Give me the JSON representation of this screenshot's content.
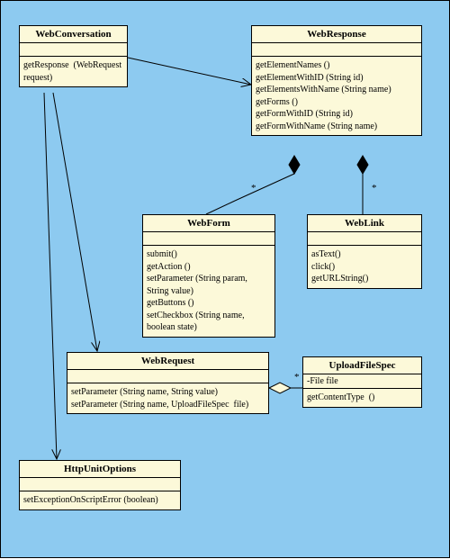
{
  "classes": {
    "WebConversation": {
      "name": "WebConversation",
      "ops": [
        "getResponse  (WebRequest request)"
      ]
    },
    "WebResponse": {
      "name": "WebResponse",
      "ops": [
        "getElementNames ()",
        "getElementWithID (String id)",
        "getElementsWithName (String name)",
        "getForms ()",
        "getFormWithID (String id)",
        "getFormWithName (String name)"
      ]
    },
    "WebForm": {
      "name": "WebForm",
      "ops": [
        "submit()",
        "getAction ()",
        "setParameter (String param, String value)",
        "getButtons ()",
        "setCheckbox (String name, boolean state)"
      ]
    },
    "WebLink": {
      "name": "WebLink",
      "ops": [
        "asText()",
        "click()",
        "getURLString()"
      ]
    },
    "WebRequest": {
      "name": "WebRequest",
      "ops": [
        "setParameter (String name, String value)",
        "setParameter (String name, UploadFileSpec  file)"
      ]
    },
    "UploadFileSpec": {
      "name": "UploadFileSpec",
      "attrs": [
        "-File file"
      ],
      "ops": [
        "getContentType  ()"
      ]
    },
    "HttpUnitOptions": {
      "name": "HttpUnitOptions",
      "ops": [
        "setExceptionOnScriptError (boolean)"
      ]
    }
  },
  "mult": {
    "star": "*"
  }
}
